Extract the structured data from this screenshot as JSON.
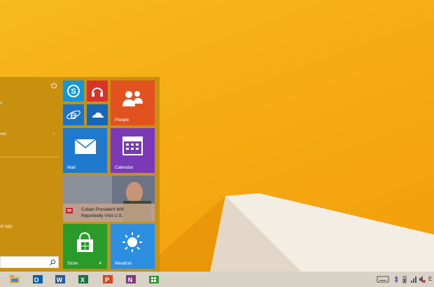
{
  "start_menu": {
    "left_items": [
      {
        "label": "s"
      },
      {
        "label": "nel"
      },
      {
        "label": "st app"
      }
    ],
    "chevron": "›",
    "search": {
      "placeholder": ""
    }
  },
  "tiles": {
    "people": {
      "label": "People"
    },
    "mail": {
      "label": "Mail"
    },
    "calendar": {
      "label": "Calendar"
    },
    "news": {
      "headline_line1": "Cuban President Will",
      "headline_line2": "Reportedly Visit U.S."
    },
    "store": {
      "label": "Store",
      "badge": "4"
    },
    "weather": {
      "label": "Weather"
    }
  },
  "taskbar": {
    "apps": [
      {
        "name": "file-explorer-icon"
      },
      {
        "name": "outlook-icon",
        "letter": "O"
      },
      {
        "name": "word-icon",
        "letter": "W"
      },
      {
        "name": "excel-icon",
        "letter": "X"
      },
      {
        "name": "powerpoint-icon",
        "letter": "P"
      },
      {
        "name": "onenote-icon",
        "letter": "N"
      },
      {
        "name": "store-icon"
      }
    ],
    "tray_edge_text": "E"
  },
  "colors": {
    "start_menu": "#c98f0e",
    "people_tile": "#e1521e",
    "mail_tile": "#1f79cc",
    "calendar_tile": "#7a3ab5",
    "store_tile": "#2a9a2a",
    "weather_tile": "#2b8ee0",
    "skype_tile": "#1595d6",
    "music_tile": "#d8332a",
    "ie_tile": "#1c73c8",
    "onedrive_tile": "#1767b8",
    "taskbar": "#d9d3c7"
  }
}
